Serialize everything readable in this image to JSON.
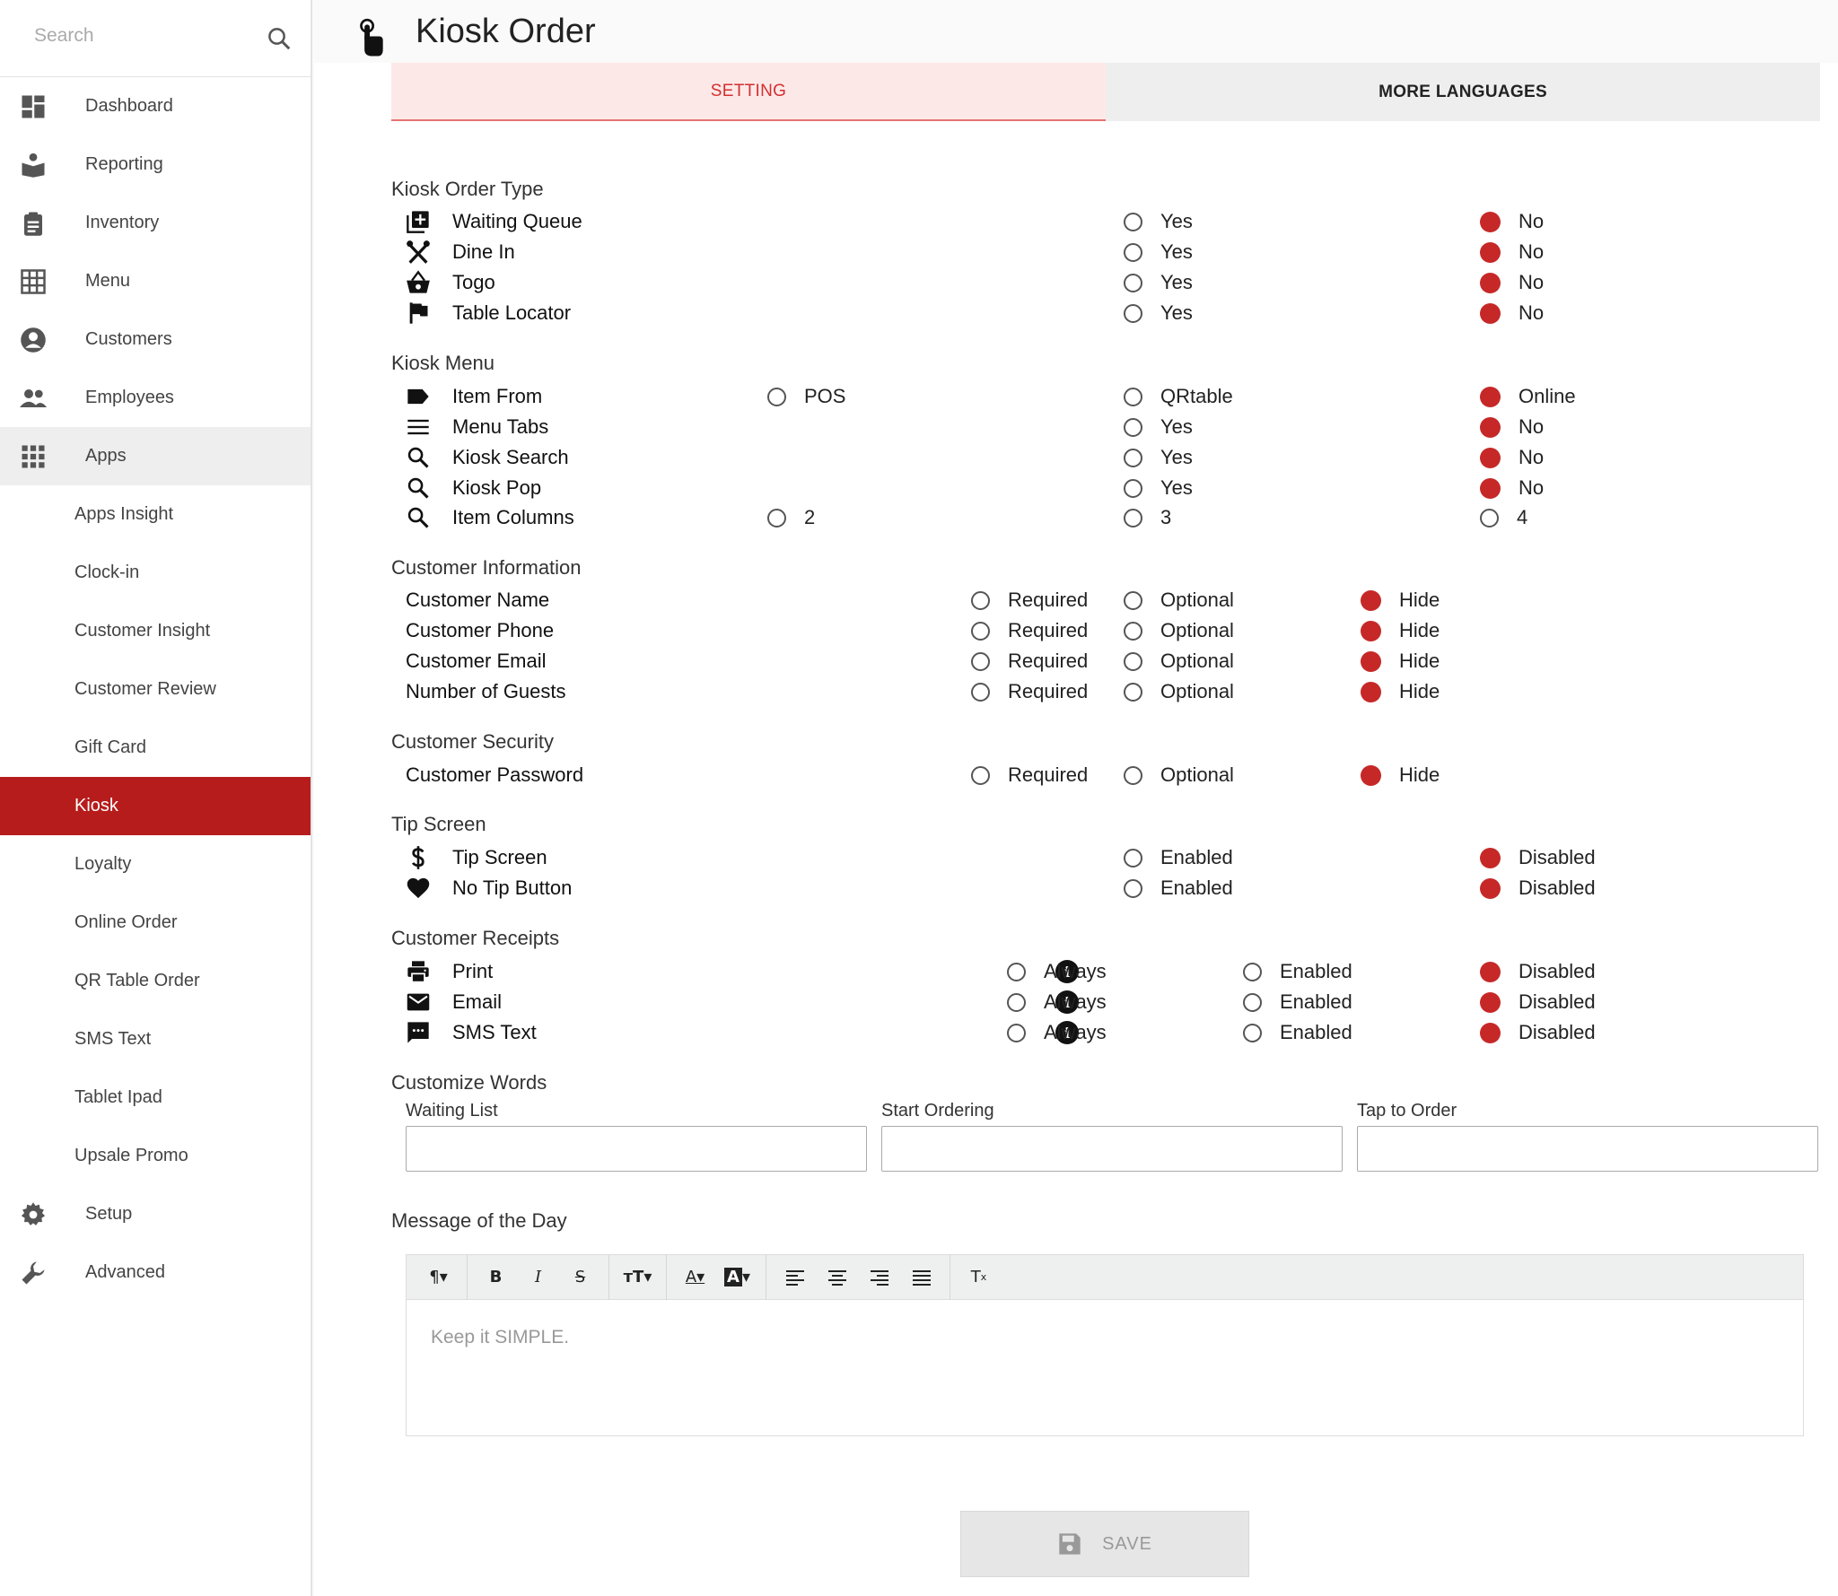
{
  "search": {
    "placeholder": "Search"
  },
  "sidebar": {
    "nav_top": [
      {
        "label": "Dashboard",
        "icon": "dashboard-icon"
      },
      {
        "label": "Reporting",
        "icon": "reporting-icon"
      },
      {
        "label": "Inventory",
        "icon": "clipboard-icon"
      },
      {
        "label": "Menu",
        "icon": "grid-icon"
      },
      {
        "label": "Customers",
        "icon": "account-circle-icon"
      },
      {
        "label": "Employees",
        "icon": "people-icon"
      },
      {
        "label": "Apps",
        "icon": "apps-icon"
      }
    ],
    "apps_items": [
      "Apps Insight",
      "Clock-in",
      "Customer Insight",
      "Customer Review",
      "Gift Card",
      "Kiosk",
      "Loyalty",
      "Online Order",
      "QR Table Order",
      "SMS Text",
      "Tablet Ipad",
      "Upsale Promo"
    ],
    "nav_bottom": [
      {
        "label": "Setup",
        "icon": "gear-icon"
      },
      {
        "label": "Advanced",
        "icon": "wrench-icon"
      }
    ],
    "active_item": "Kiosk"
  },
  "header": {
    "title": "Kiosk Order"
  },
  "tabs": {
    "setting": "SETTING",
    "more_languages": "MORE LANGUAGES"
  },
  "sections": {
    "order_type": {
      "title": "Kiosk Order Type",
      "rows": [
        {
          "label": "Waiting Queue",
          "icon": "queue-add-icon",
          "opt1": "Yes",
          "opt2": "No",
          "selected": "No"
        },
        {
          "label": "Dine In",
          "icon": "utensils-icon",
          "opt1": "Yes",
          "opt2": "No",
          "selected": "No"
        },
        {
          "label": "Togo",
          "icon": "basket-icon",
          "opt1": "Yes",
          "opt2": "No",
          "selected": "No"
        },
        {
          "label": "Table Locator",
          "icon": "flag-icon",
          "opt1": "Yes",
          "opt2": "No",
          "selected": "No"
        }
      ]
    },
    "menu": {
      "title": "Kiosk Menu",
      "rows": [
        {
          "label": "Item From",
          "icon": "label-icon",
          "opt0": "POS",
          "opt1": "QRtable",
          "opt2": "Online",
          "selected": "Online"
        },
        {
          "label": "Menu Tabs",
          "icon": "menu-lines-icon",
          "opt1": "Yes",
          "opt2": "No",
          "selected": "No"
        },
        {
          "label": "Kiosk Search",
          "icon": "search-icon",
          "opt1": "Yes",
          "opt2": "No",
          "selected": "No"
        },
        {
          "label": "Kiosk Pop",
          "icon": "search-icon",
          "opt1": "Yes",
          "opt2": "No",
          "selected": "No"
        },
        {
          "label": "Item Columns",
          "icon": "search-icon",
          "opt0": "2",
          "opt1": "3",
          "opt2": "4",
          "selected": ""
        }
      ]
    },
    "customer_info": {
      "title": "Customer Information",
      "rows": [
        {
          "label": "Customer Name",
          "opt1": "Required",
          "opt2": "Optional",
          "opt3": "Hide",
          "selected": "Hide"
        },
        {
          "label": "Customer Phone",
          "opt1": "Required",
          "opt2": "Optional",
          "opt3": "Hide",
          "selected": "Hide"
        },
        {
          "label": "Customer Email",
          "opt1": "Required",
          "opt2": "Optional",
          "opt3": "Hide",
          "selected": "Hide"
        },
        {
          "label": "Number of Guests",
          "opt1": "Required",
          "opt2": "Optional",
          "opt3": "Hide",
          "selected": "Hide"
        }
      ]
    },
    "security": {
      "title": "Customer Security",
      "rows": [
        {
          "label": "Customer Password",
          "opt1": "Required",
          "opt2": "Optional",
          "opt3": "Hide",
          "selected": "Hide"
        }
      ]
    },
    "tip": {
      "title": "Tip Screen",
      "rows": [
        {
          "label": "Tip Screen",
          "icon": "dollar-icon",
          "opt1": "Enabled",
          "opt2": "Disabled",
          "selected": "Disabled"
        },
        {
          "label": "No Tip Button",
          "icon": "heart-icon",
          "opt1": "Enabled",
          "opt2": "Disabled",
          "selected": "Disabled"
        }
      ]
    },
    "receipts": {
      "title": "Customer Receipts",
      "rows": [
        {
          "label": "Print",
          "icon": "printer-icon",
          "opt1": "Always",
          "opt2": "Enabled",
          "opt3": "Disabled",
          "selected": "Disabled"
        },
        {
          "label": "Email",
          "icon": "mail-icon",
          "opt1": "Always",
          "opt2": "Enabled",
          "opt3": "Disabled",
          "selected": "Disabled"
        },
        {
          "label": "SMS Text",
          "icon": "chat-icon",
          "opt1": "Always",
          "opt2": "Enabled",
          "opt3": "Disabled",
          "selected": "Disabled"
        }
      ]
    },
    "customize_words": {
      "title": "Customize Words",
      "fields": [
        {
          "label": "Waiting List",
          "value": ""
        },
        {
          "label": "Start Ordering",
          "value": ""
        },
        {
          "label": "Tap to Order",
          "value": ""
        }
      ]
    },
    "message": {
      "title": "Message of the Day",
      "placeholder": "Keep it SIMPLE."
    }
  },
  "save": {
    "label": "SAVE"
  },
  "colors": {
    "accent": "#b71c1c",
    "radio_selected": "#c62828",
    "tab_active_bg": "#fde8e8",
    "tab_active_text": "#d32f2f"
  }
}
